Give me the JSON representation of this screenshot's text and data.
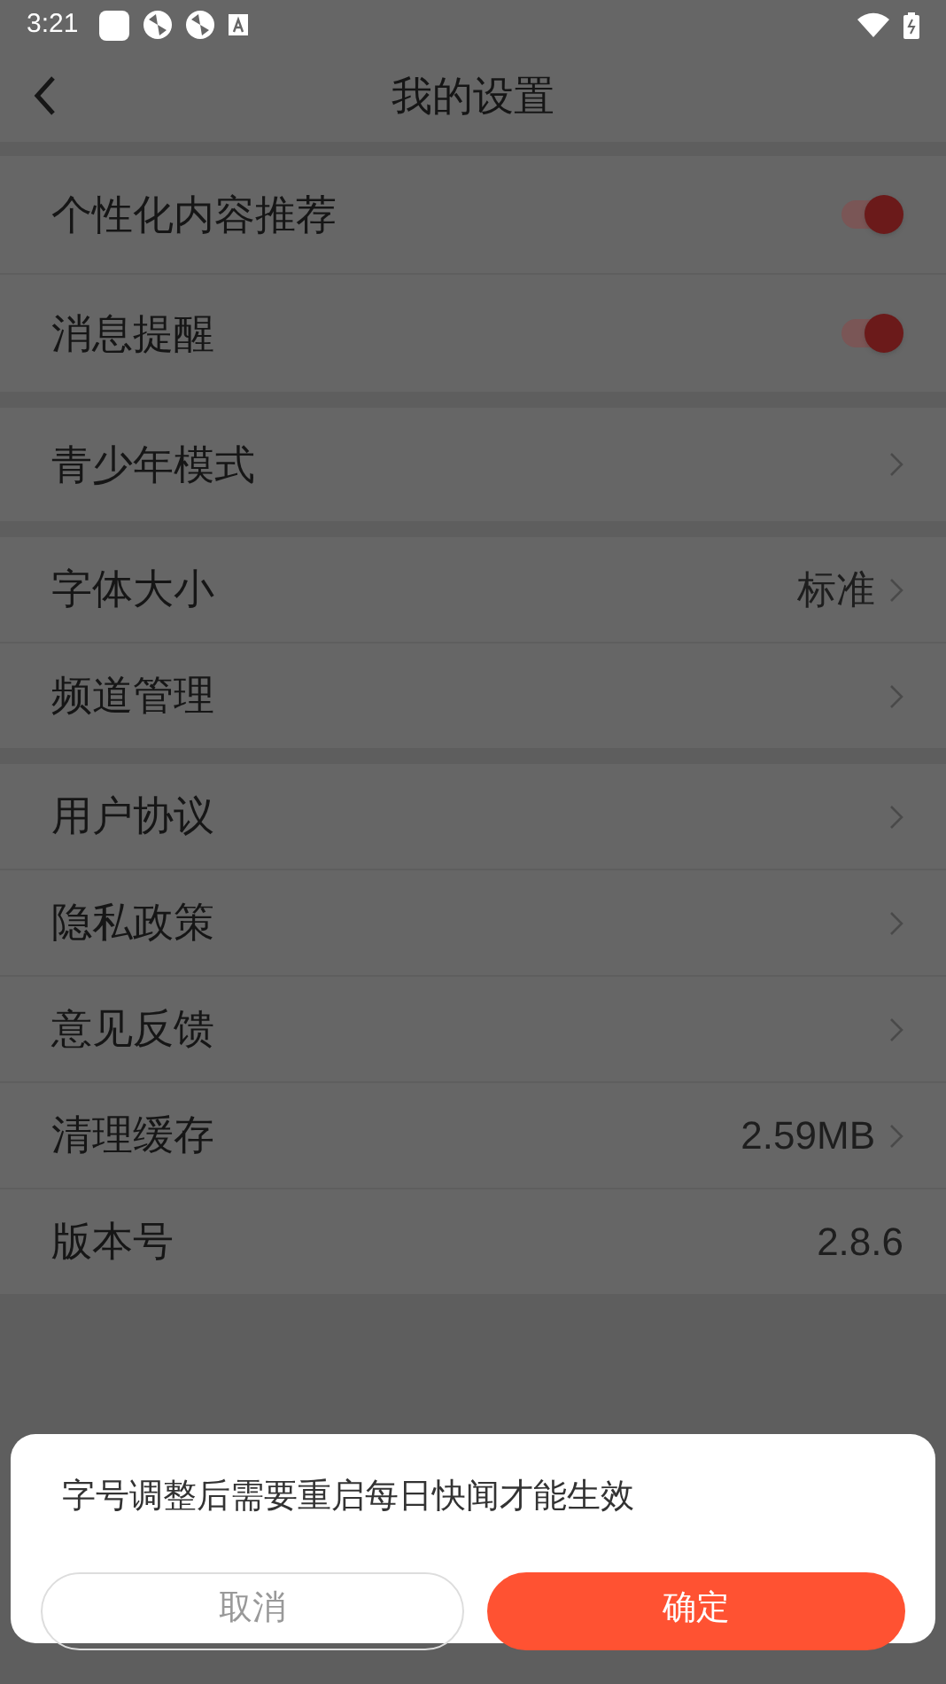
{
  "status_bar": {
    "time": "3:21"
  },
  "header": {
    "title": "我的设置"
  },
  "groups": [
    {
      "items": [
        {
          "kind": "toggle",
          "label": "个性化内容推荐",
          "on": true
        },
        {
          "kind": "toggle",
          "label": "消息提醒",
          "on": true
        }
      ]
    },
    {
      "items": [
        {
          "kind": "link",
          "label": "青少年模式"
        }
      ]
    },
    {
      "items": [
        {
          "kind": "link",
          "label": "字体大小",
          "value": "标准"
        },
        {
          "kind": "link",
          "label": "频道管理"
        }
      ]
    },
    {
      "items": [
        {
          "kind": "link",
          "label": "用户协议"
        },
        {
          "kind": "link",
          "label": "隐私政策"
        },
        {
          "kind": "link",
          "label": "意见反馈"
        },
        {
          "kind": "link",
          "label": "清理缓存",
          "value": "2.59MB"
        },
        {
          "kind": "info",
          "label": "版本号",
          "value": "2.8.6"
        }
      ]
    }
  ],
  "dialog": {
    "message": "字号调整后需要重启每日快闻才能生效",
    "cancel": "取消",
    "confirm": "确定"
  }
}
